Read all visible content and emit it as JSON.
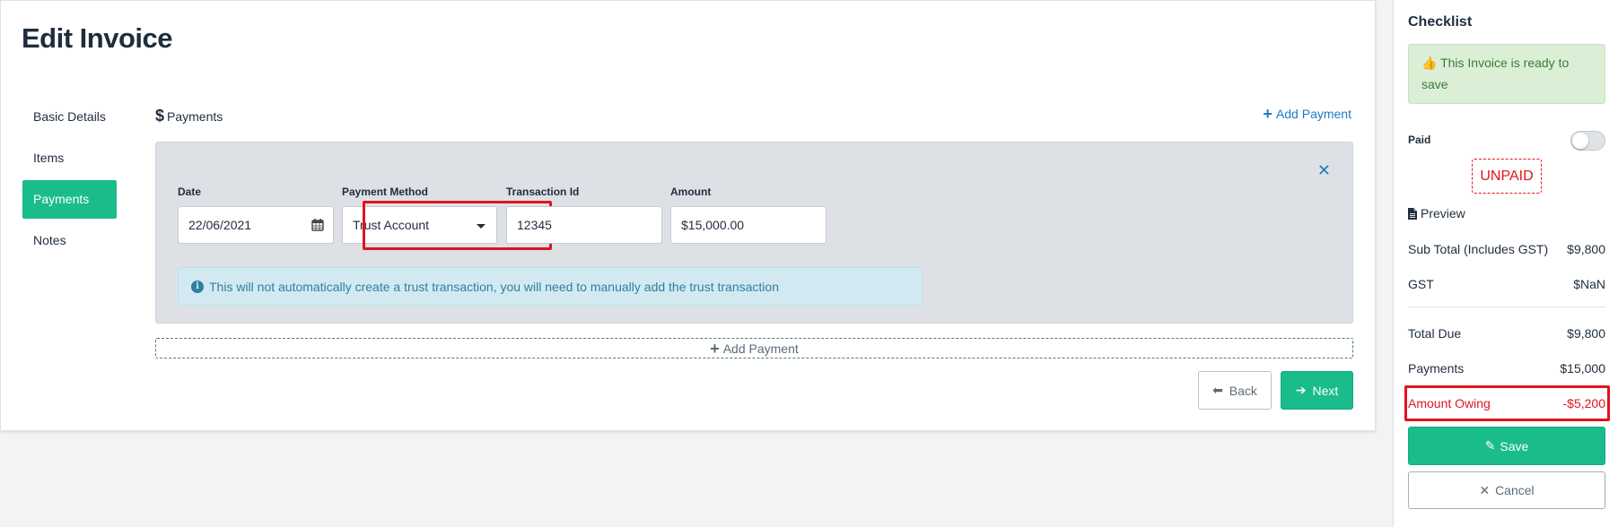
{
  "page": {
    "title": "Edit Invoice"
  },
  "nav": {
    "items": [
      {
        "label": "Basic Details"
      },
      {
        "label": "Items"
      },
      {
        "label": "Payments",
        "active": true
      },
      {
        "label": "Notes"
      }
    ]
  },
  "payments": {
    "section_icon": "dollar-icon",
    "section_label": "Payments",
    "add_label": "Add Payment",
    "rows": [
      {
        "date_label": "Date",
        "date_value": "22/06/2021",
        "method_label": "Payment Method",
        "method_value": "Trust Account",
        "transaction_label": "Transaction Id",
        "transaction_value": "12345",
        "amount_label": "Amount",
        "amount_value": "$15,000.00",
        "info_text": "This will not automatically create a trust transaction, you will need to manually add the trust transaction"
      }
    ],
    "add_dashed_label": "Add Payment"
  },
  "actions": {
    "back_label": "Back",
    "next_label": "Next"
  },
  "checklist": {
    "title": "Checklist",
    "ready_text": "This Invoice is ready to save",
    "paid_label": "Paid",
    "paid_toggle": false,
    "status": "UNPAID",
    "preview_label": "Preview",
    "subtotal_label": "Sub Total (Includes GST)",
    "subtotal_value": "$9,800",
    "gst_label": "GST",
    "gst_value": "$NaN",
    "total_due_label": "Total Due",
    "total_due_value": "$9,800",
    "payments_label": "Payments",
    "payments_value": "$15,000",
    "owing_label": "Amount Owing",
    "owing_value": "-$5,200",
    "save_label": "Save",
    "cancel_label": "Cancel"
  },
  "colors": {
    "primary": "#1abc8c",
    "link": "#1f7ac4",
    "danger": "#e0141e",
    "success_bg": "#dbefd6",
    "info_bg": "#d3e9f1"
  }
}
